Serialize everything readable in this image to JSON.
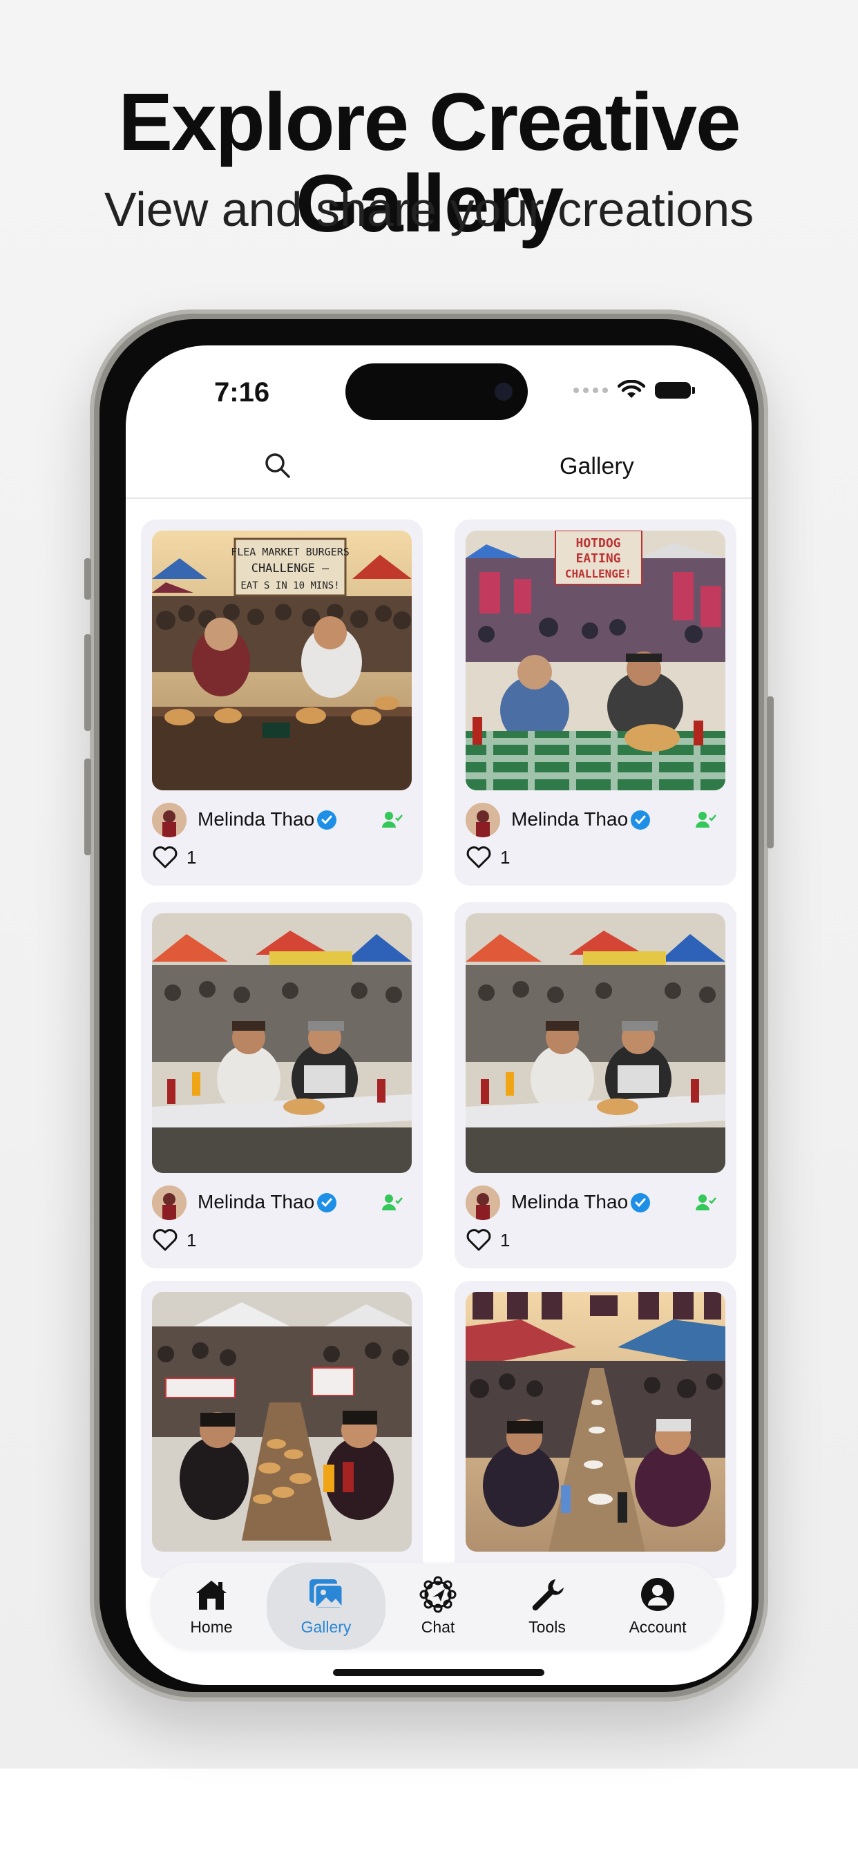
{
  "promo": {
    "headline": "Explore Creative Gallery",
    "subhead": "View and share your creations"
  },
  "status_bar": {
    "time": "7:16"
  },
  "header": {
    "title": "Gallery"
  },
  "colors": {
    "accent": "#2a86d6",
    "verified": "#1d8fe6",
    "follow": "#34c759",
    "card_bg": "#f1f0f6"
  },
  "posts": [
    {
      "user": "Melinda Thao",
      "likes": "1",
      "photo_text_1": "FLEA MARKET BURGERS",
      "photo_text_2": "CHALLENGE –",
      "photo_text_3": "EAT S IN 10 MINS!"
    },
    {
      "user": "Melinda Thao",
      "likes": "1",
      "photo_text_1": "HOTDOG",
      "photo_text_2": "EATING",
      "photo_text_3": "CHALLENGE!"
    },
    {
      "user": "Melinda Thao",
      "likes": "1"
    },
    {
      "user": "Melinda Thao",
      "likes": "1"
    },
    {
      "user": "",
      "likes": ""
    },
    {
      "user": "",
      "likes": ""
    }
  ],
  "tabs": [
    {
      "label": "Home",
      "icon": "home-icon"
    },
    {
      "label": "Gallery",
      "icon": "gallery-icon",
      "active": true
    },
    {
      "label": "Chat",
      "icon": "chat-icon"
    },
    {
      "label": "Tools",
      "icon": "tools-icon"
    },
    {
      "label": "Account",
      "icon": "account-icon"
    }
  ]
}
